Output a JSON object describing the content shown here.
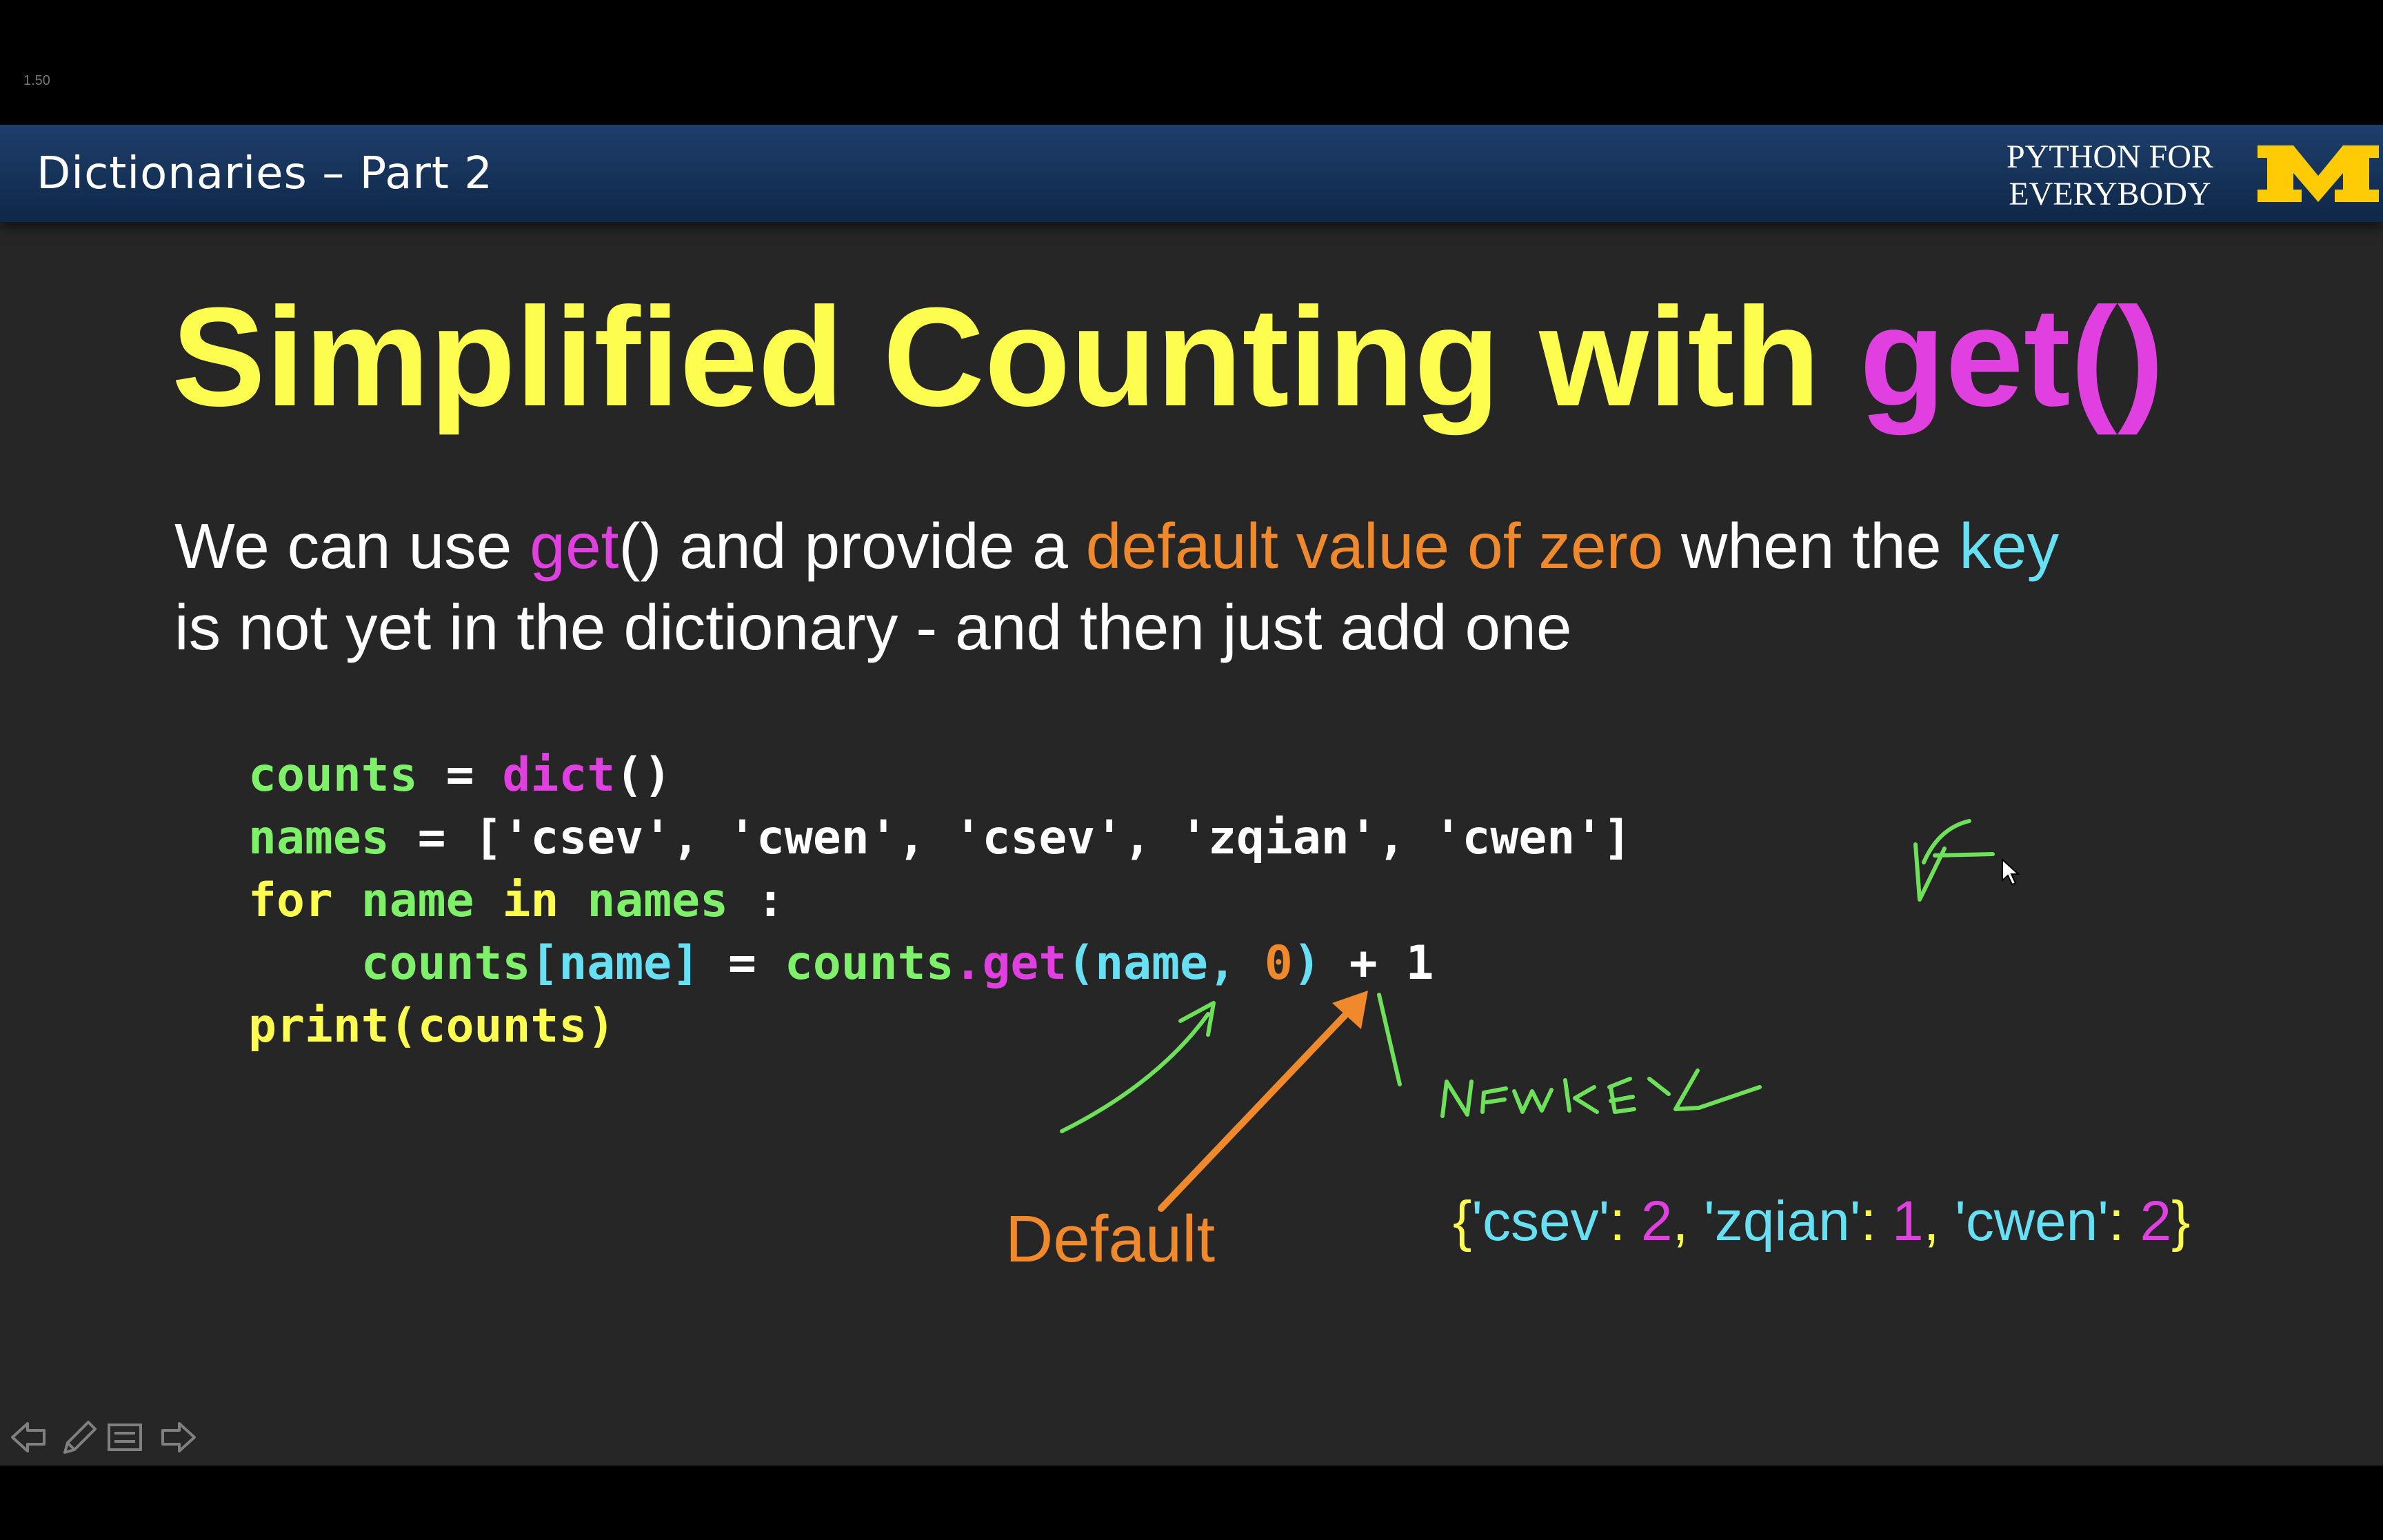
{
  "player": {
    "speed_label": "1.50"
  },
  "header": {
    "title": "Dictionaries – Part 2",
    "brand_line1": "PYTHON FOR",
    "brand_line2": "EVERYBODY",
    "logo_letter": "M"
  },
  "slide": {
    "title_main": "Simplified Counting with ",
    "title_highlight": "get()",
    "intro": {
      "t1": "We can use ",
      "t2": "get",
      "t3": "() and provide a ",
      "t4": "default value of zero",
      "t5": " when the ",
      "t6": "key",
      "t7": "is not yet in the dictionary - and then just add one"
    },
    "code": {
      "l1": [
        "counts",
        " = ",
        "dict",
        "()"
      ],
      "l2": [
        "names",
        " = [",
        "'csev'",
        ", ",
        "'cwen'",
        ", ",
        "'csev'",
        ", ",
        "'zqian'",
        ", ",
        "'cwen'",
        "]"
      ],
      "l3": [
        "for",
        " ",
        "name",
        " ",
        "in",
        " ",
        "names",
        " :"
      ],
      "l4": [
        "    ",
        "counts",
        "[name]",
        " = ",
        "counts",
        ".get",
        "(name, ",
        "0",
        ")",
        " + 1"
      ],
      "l5": [
        "print",
        "(counts)"
      ]
    },
    "default_label": "Default",
    "output": {
      "brace_open": "{",
      "k1": "'csev'",
      "v1": "2",
      "k2": "'zqian'",
      "v2": "1",
      "k3": "'cwen'",
      "v3": "2",
      "brace_close": "}",
      "colon": ": ",
      "sep": ", "
    }
  },
  "annotations": {
    "handwriting_text": "NEWKEY"
  },
  "colors": {
    "yellow": "#fdfd50",
    "pink": "#e040e0",
    "orange": "#f0882c",
    "cyan": "#66e0f2",
    "green": "#7ef06a",
    "header_blue": "#1a3a66",
    "logo_gold": "#ffcb05"
  },
  "nav": {
    "icons": [
      "back-arrow-icon",
      "pencil-icon",
      "menu-icon",
      "forward-arrow-icon"
    ]
  }
}
